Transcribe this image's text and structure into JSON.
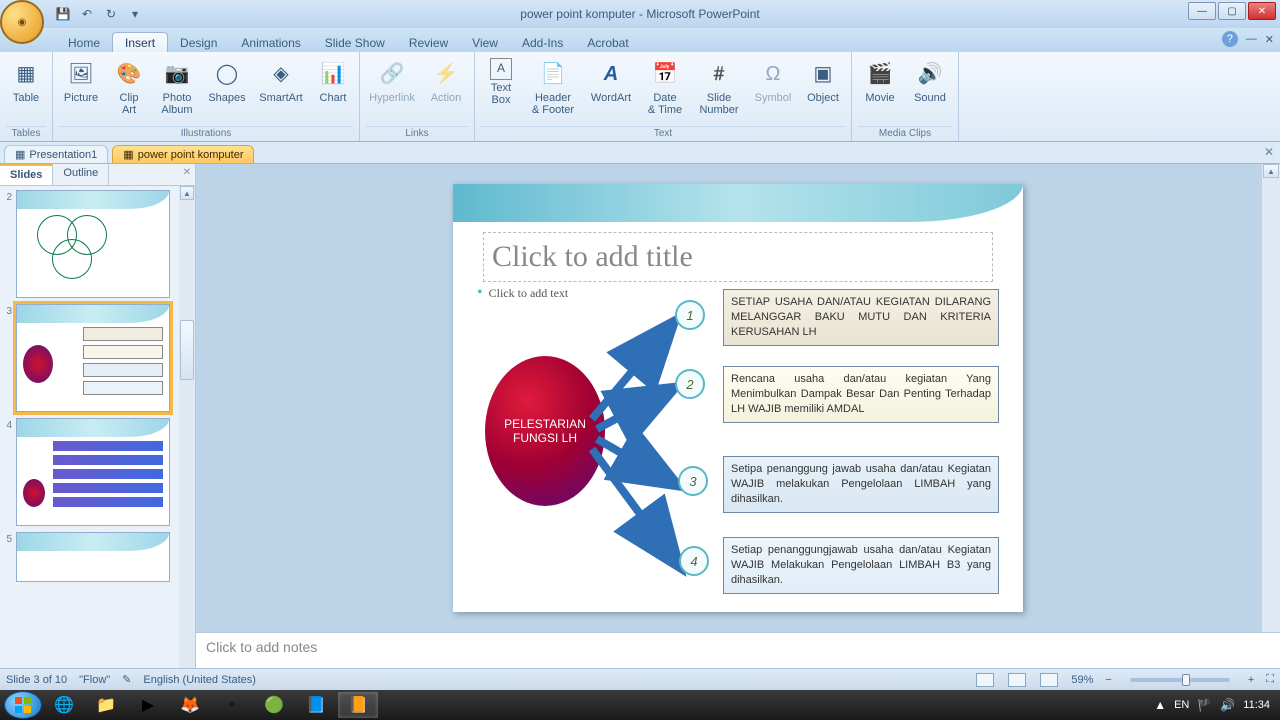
{
  "titlebar": {
    "title": "power point komputer - Microsoft PowerPoint"
  },
  "tabs": {
    "home": "Home",
    "insert": "Insert",
    "design": "Design",
    "animations": "Animations",
    "slideshow": "Slide Show",
    "review": "Review",
    "view": "View",
    "addins": "Add-Ins",
    "acrobat": "Acrobat"
  },
  "ribbon": {
    "tables": {
      "table": "Table",
      "group": "Tables"
    },
    "illustrations": {
      "picture": "Picture",
      "clipart": "Clip\nArt",
      "photoalbum": "Photo\nAlbum",
      "shapes": "Shapes",
      "smartart": "SmartArt",
      "chart": "Chart",
      "group": "Illustrations"
    },
    "links": {
      "hyperlink": "Hyperlink",
      "action": "Action",
      "group": "Links"
    },
    "text": {
      "textbox": "Text\nBox",
      "headerfooter": "Header\n& Footer",
      "wordart": "WordArt",
      "datetime": "Date\n& Time",
      "slidenumber": "Slide\nNumber",
      "symbol": "Symbol",
      "object": "Object",
      "group": "Text"
    },
    "media": {
      "movie": "Movie",
      "sound": "Sound",
      "group": "Media Clips"
    }
  },
  "doctabs": {
    "pres1": "Presentation1",
    "doc": "power point komputer"
  },
  "slidespanel": {
    "slides": "Slides",
    "outline": "Outline",
    "nums": [
      "2",
      "3",
      "4",
      "5"
    ]
  },
  "slide": {
    "title_placeholder": "Click to add title",
    "text_placeholder": "Click to add text",
    "circle": "PELESTARIAN FUNGSI LH",
    "n1": "1",
    "n2": "2",
    "n3": "3",
    "n4": "4",
    "box1": "SETIAP USAHA DAN/ATAU KEGIATAN DILARANG MELANGGAR BAKU MUTU DAN KRITERIA KERUSAHAN LH",
    "box2": "Rencana usaha dan/atau kegiatan Yang Menimbulkan Dampak Besar Dan Penting Terhadap LH WAJIB memiliki AMDAL",
    "box3": "Setipa penanggung jawab usaha dan/atau Kegiatan WAJIB melakukan Pengelolaan LIMBAH yang dihasilkan.",
    "box4": "Setiap penanggungjawab usaha dan/atau Kegiatan WAJIB Melakukan Pengelolaan LIMBAH B3 yang dihasilkan."
  },
  "notes": {
    "placeholder": "Click to add notes"
  },
  "status": {
    "slide": "Slide 3 of 10",
    "theme": "\"Flow\"",
    "lang": "English (United States)",
    "zoom": "59%"
  },
  "tray": {
    "lang": "EN",
    "time": "11:34"
  }
}
